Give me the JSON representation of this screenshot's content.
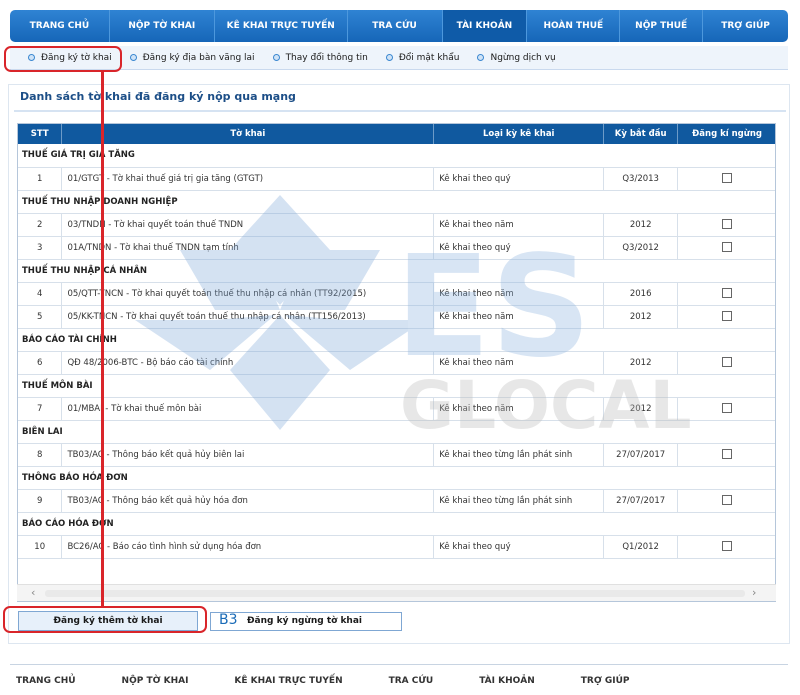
{
  "topnav": [
    {
      "label": "TRANG CHỦ"
    },
    {
      "label": "NỘP TỜ KHAI"
    },
    {
      "label": "KÊ KHAI TRỰC TUYẾN"
    },
    {
      "label": "TRA CỨU"
    },
    {
      "label": "TÀI KHOẢN",
      "active": true
    },
    {
      "label": "HOÀN THUẾ"
    },
    {
      "label": "NỘP THUẾ"
    },
    {
      "label": "TRỢ GIÚP"
    }
  ],
  "subnav": [
    {
      "label": "Đăng ký tờ khai"
    },
    {
      "label": "Đăng ký địa bàn vãng lai"
    },
    {
      "label": "Thay đổi thông tin"
    },
    {
      "label": "Đổi mật khẩu"
    },
    {
      "label": "Ngừng dịch vụ"
    }
  ],
  "panel": {
    "title": "Danh sách tờ khai đã đăng ký nộp qua mạng"
  },
  "table": {
    "headers": [
      "STT",
      "Tờ khai",
      "Loại kỳ kê khai",
      "Kỳ bắt đầu",
      "Đăng kí ngừng"
    ],
    "groups": [
      {
        "name": "THUẾ GIÁ TRỊ GIA TĂNG",
        "rows": [
          {
            "stt": "1",
            "form": "01/GTGT - Tờ khai thuế giá trị gia tăng (GTGT)",
            "period_type": "Kê khai theo quý",
            "start": "Q3/2013",
            "stop": false
          }
        ]
      },
      {
        "name": "THUẾ THU NHẬP DOANH NGHIỆP",
        "rows": [
          {
            "stt": "2",
            "form": "03/TNDN - Tờ khai quyết toán thuế TNDN",
            "period_type": "Kê khai theo năm",
            "start": "2012",
            "stop": false
          },
          {
            "stt": "3",
            "form": "01A/TNDN - Tờ khai thuế TNDN tạm tính",
            "period_type": "Kê khai theo quý",
            "start": "Q3/2012",
            "stop": false
          }
        ]
      },
      {
        "name": "THUẾ THU NHẬP CÁ NHÂN",
        "rows": [
          {
            "stt": "4",
            "form": "05/QTT-TNCN - Tờ khai quyết toán thuế thu nhập cá nhân (TT92/2015)",
            "period_type": "Kê khai theo năm",
            "start": "2016",
            "stop": false
          },
          {
            "stt": "5",
            "form": "05/KK-TNCN - Tờ khai quyết toán thuế thu nhập cá nhân (TT156/2013)",
            "period_type": "Kê khai theo năm",
            "start": "2012",
            "stop": false
          }
        ]
      },
      {
        "name": "BÁO CÁO TÀI CHÍNH",
        "rows": [
          {
            "stt": "6",
            "form": "QĐ 48/2006-BTC - Bộ báo cáo tài chính",
            "period_type": "Kê khai theo năm",
            "start": "2012",
            "stop": false
          }
        ]
      },
      {
        "name": "THUẾ MÔN BÀI",
        "rows": [
          {
            "stt": "7",
            "form": "01/MBAI - Tờ khai thuế môn bài",
            "period_type": "Kê khai theo năm",
            "start": "2012",
            "stop": false
          }
        ]
      },
      {
        "name": "BIÊN LAI",
        "rows": [
          {
            "stt": "8",
            "form": "TB03/AC - Thông báo kết quả hủy biên lai",
            "period_type": "Kê khai theo từng lần phát sinh",
            "start": "27/07/2017",
            "stop": false
          }
        ]
      },
      {
        "name": "THÔNG BÁO HÓA ĐƠN",
        "rows": [
          {
            "stt": "9",
            "form": "TB03/AC - Thông báo kết quả hủy hóa đơn",
            "period_type": "Kê khai theo từng lần phát sinh",
            "start": "27/07/2017",
            "stop": false
          }
        ]
      },
      {
        "name": "BÁO CÁO HÓA ĐƠN",
        "rows": [
          {
            "stt": "10",
            "form": "BC26/AC - Báo cáo tình hình sử dụng hóa đơn",
            "period_type": "Kê khai theo quý",
            "start": "Q1/2012",
            "stop": false
          }
        ]
      }
    ]
  },
  "scrollbar": {
    "left_icon": "chevron-left-icon",
    "right_icon": "chevron-right-icon"
  },
  "watermark": {
    "line1": "ES",
    "line2": "GLOCAL"
  },
  "buttons": {
    "add": "Đăng ký thêm tờ khai",
    "stop": "Đăng ký ngừng tờ khai"
  },
  "annotation": {
    "step": "B3",
    "color": "#d9252a"
  },
  "footer": [
    {
      "label": "TRANG CHỦ"
    },
    {
      "label": "NỘP TỜ KHAI"
    },
    {
      "label": "KÊ KHAI TRỰC TUYẾN"
    },
    {
      "label": "TRA CỨU"
    },
    {
      "label": "TÀI KHOẢN"
    },
    {
      "label": "TRỢ GIÚP"
    }
  ],
  "colors": {
    "nav": "#1666b8",
    "header": "#10599f",
    "accent": "#3a87d0"
  }
}
